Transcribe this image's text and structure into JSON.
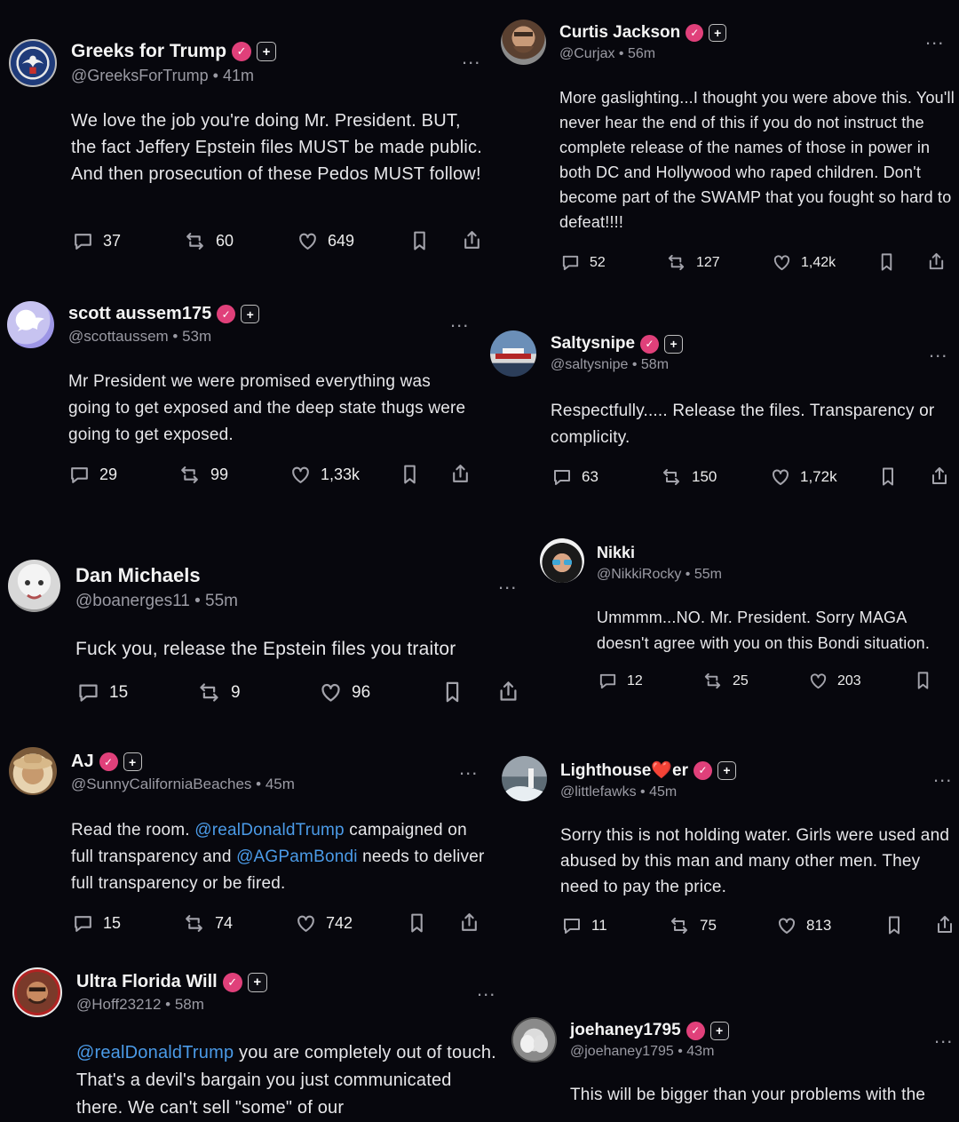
{
  "posts": [
    {
      "name": "Greeks for Trump",
      "handle": "@GreeksForTrump",
      "time": "41m",
      "text": "We love the job you're doing Mr. President. BUT, the fact Jeffery Epstein files MUST be made public. And then prosecution of these Pedos MUST follow!",
      "replies": "37",
      "reposts": "60",
      "likes": "649"
    },
    {
      "name": "Curtis Jackson",
      "handle": "@Curjax",
      "time": "56m",
      "text": "More gaslighting...I thought you were above this. You'll never hear the end of this if you do not instruct the complete release of the names of those in power in both DC and Hollywood who raped children. Don't become part of the SWAMP that you fought so hard to defeat!!!!",
      "replies": "52",
      "reposts": "127",
      "likes": "1,42k"
    },
    {
      "name": "scott aussem175",
      "handle": "@scottaussem",
      "time": "53m",
      "text": "Mr President we were promised everything was going to get exposed and the deep state thugs were going to get exposed.",
      "replies": "29",
      "reposts": "99",
      "likes": "1,33k"
    },
    {
      "name": "Saltysnipe",
      "handle": "@saltysnipe",
      "time": "58m",
      "text": "Respectfully..... Release the files. Transparency or complicity.",
      "replies": "63",
      "reposts": "150",
      "likes": "1,72k"
    },
    {
      "name": "Dan Michaels",
      "handle": "@boanerges11",
      "time": "55m",
      "text": "Fuck you, release the Epstein files you traitor",
      "replies": "15",
      "reposts": "9",
      "likes": "96"
    },
    {
      "name": "Nikki",
      "handle": "@NikkiRocky",
      "time": "55m",
      "text": "Ummmm...NO. Mr. President. Sorry MAGA doesn't agree with you on this Bondi situation.",
      "replies": "12",
      "reposts": "25",
      "likes": "203"
    },
    {
      "name": "AJ",
      "handle": "@SunnyCaliforniaBeaches",
      "time": "45m",
      "text_a": "Read the room. ",
      "mention_a": "@realDonaldTrump",
      "text_b": " campaigned on full transparency and ",
      "mention_b": "@AGPamBondi",
      "text_c": " needs to deliver full transparency or be fired.",
      "replies": "15",
      "reposts": "74",
      "likes": "742"
    },
    {
      "name": "Lighthouse❤️er",
      "handle": "@littlefawks",
      "time": "45m",
      "text": "Sorry this is not holding water. Girls were used and abused by this man and many other men. They need to pay the price.",
      "replies": "11",
      "reposts": "75",
      "likes": "813"
    },
    {
      "name": "Ultra Florida Will",
      "handle": "@Hoff23212",
      "time": "58m",
      "mention_a": "@realDonaldTrump",
      "text_b": " you are completely out of touch. That's a devil's bargain you just communicated there. We can't sell \"some\" of our",
      "replies": "",
      "reposts": "",
      "likes": ""
    },
    {
      "name": "joehaney1795",
      "handle": "@joehaney1795",
      "time": "43m",
      "text": "This will be bigger than your problems with the",
      "replies": "",
      "reposts": "",
      "likes": ""
    }
  ],
  "dot": " • ",
  "more": "...",
  "verified_glyph": "✓",
  "plus_glyph": "+",
  "colors": {
    "verified": "#e0407a",
    "mention": "#4b9be8",
    "bg": "#07070d",
    "muted": "#9a9aa3"
  }
}
